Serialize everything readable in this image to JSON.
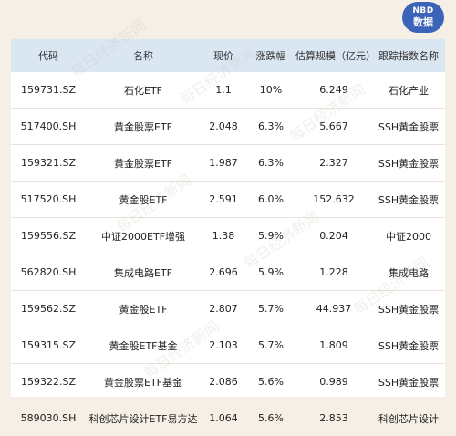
{
  "brand": {
    "line1": "NBD",
    "line2": "数据"
  },
  "watermark": "每日经济新闻",
  "headers": [
    "代码",
    "名称",
    "现价",
    "涨跌幅",
    "估算规模（亿元）",
    "跟踪指数名称"
  ],
  "rows": [
    [
      "159731.SZ",
      "石化ETF",
      "1.1",
      "10%",
      "6.249",
      "石化产业"
    ],
    [
      "517400.SH",
      "黄金股票ETF",
      "2.048",
      "6.3%",
      "5.667",
      "SSH黄金股票"
    ],
    [
      "159321.SZ",
      "黄金股票ETF",
      "1.987",
      "6.3%",
      "2.327",
      "SSH黄金股票"
    ],
    [
      "517520.SH",
      "黄金股ETF",
      "2.591",
      "6.0%",
      "152.632",
      "SSH黄金股票"
    ],
    [
      "159556.SZ",
      "中证2000ETF增强",
      "1.38",
      "5.9%",
      "0.204",
      "中证2000"
    ],
    [
      "562820.SH",
      "集成电路ETF",
      "2.696",
      "5.9%",
      "1.228",
      "集成电路"
    ],
    [
      "159562.SZ",
      "黄金股ETF",
      "2.807",
      "5.7%",
      "44.937",
      "SSH黄金股票"
    ],
    [
      "159315.SZ",
      "黄金股ETF基金",
      "2.103",
      "5.7%",
      "1.809",
      "SSH黄金股票"
    ],
    [
      "159322.SZ",
      "黄金股票ETF基金",
      "2.086",
      "5.6%",
      "0.989",
      "SSH黄金股票"
    ],
    [
      "589030.SH",
      "科创芯片设计ETF易方达",
      "1.064",
      "5.6%",
      "2.853",
      "科创芯片设计"
    ]
  ]
}
